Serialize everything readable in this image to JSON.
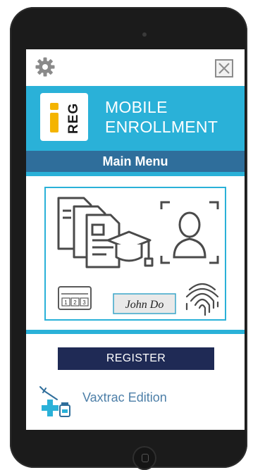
{
  "app": {
    "logo": {
      "letter": "i",
      "text": "REG"
    },
    "banner_title": [
      "MOBILE",
      "ENROLLMENT"
    ]
  },
  "menu": {
    "title": "Main Menu"
  },
  "features": {
    "signature_text": "John Do",
    "keypad_digits": [
      "1",
      "2",
      "3"
    ]
  },
  "actions": {
    "register_label": "REGISTER"
  },
  "footer": {
    "edition_label": "Vaxtrac Edition"
  },
  "icons": {
    "settings": "gear-icon",
    "close": "close-icon",
    "documents": "document-icon",
    "education": "graduation-cap-icon",
    "face": "face-scan-icon",
    "keypad": "keypad-icon",
    "signature": "signature-icon",
    "fingerprint": "fingerprint-icon",
    "vaccine": "vaccine-icon"
  },
  "colors": {
    "banner": "#2ab1d8",
    "menu_bar": "#2f6e9b",
    "register_button": "#1f2a55",
    "edition_text": "#4d7fa8",
    "logo_accent": "#f4b400"
  }
}
